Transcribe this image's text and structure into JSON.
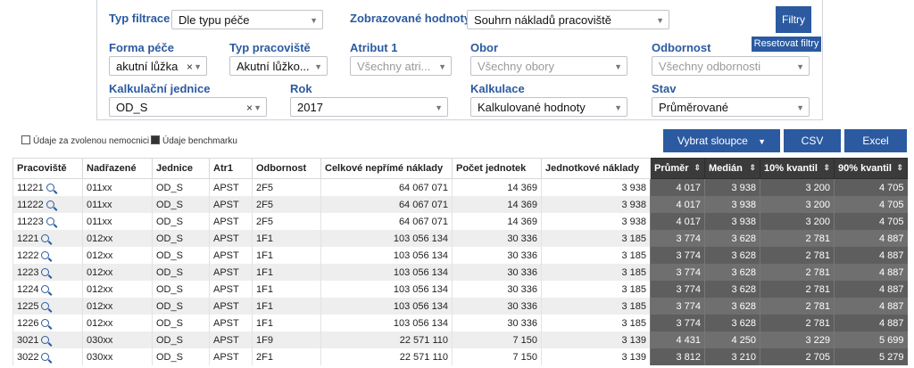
{
  "filters": {
    "typ_filtrace": {
      "label": "Typ filtrace",
      "value": "Dle typu péče"
    },
    "zobrazovane_hodnoty": {
      "label": "Zobrazované hodnoty",
      "value": "Souhrn nákladů pracoviště"
    },
    "filtry_button": "Filtry",
    "reset_button": "Resetovat filtry",
    "forma_pece": {
      "label": "Forma péče",
      "value": "akutní lůžka"
    },
    "typ_pracoviste": {
      "label": "Typ pracoviště",
      "value": "Akutní lůžko..."
    },
    "atribut1": {
      "label": "Atribut 1",
      "placeholder": "Všechny atri..."
    },
    "obor": {
      "label": "Obor",
      "placeholder": "Všechny obory"
    },
    "odbornost": {
      "label": "Odbornost",
      "placeholder": "Všechny odbornosti"
    },
    "kalkulacni_jednice": {
      "label": "Kalkulační jednice",
      "value": "OD_S"
    },
    "rok": {
      "label": "Rok",
      "value": "2017"
    },
    "kalkulace": {
      "label": "Kalkulace",
      "value": "Kalkulované hodnoty"
    },
    "stav": {
      "label": "Stav",
      "value": "Průměrované"
    }
  },
  "legend": {
    "own": "Údaje za zvolenou nemocnici",
    "benchmark": "Údaje benchmarku"
  },
  "actions": {
    "columns": "Vybrat sloupce",
    "csv": "CSV",
    "excel": "Excel"
  },
  "table": {
    "headers": [
      "Pracoviště",
      "Nadřazené",
      "Jednice",
      "Atr1",
      "Odbornost",
      "Celkové nepřímé náklady",
      "Počet jednotek",
      "Jednotkové náklady",
      "Průměr",
      "Medián",
      "10% kvantil",
      "90% kvantil"
    ],
    "rows": [
      [
        "11221",
        "011xx",
        "OD_S",
        "APST",
        "2F5",
        "64 067 071",
        "14 369",
        "3 938",
        "4 017",
        "3 938",
        "3 200",
        "4 705"
      ],
      [
        "11222",
        "011xx",
        "OD_S",
        "APST",
        "2F5",
        "64 067 071",
        "14 369",
        "3 938",
        "4 017",
        "3 938",
        "3 200",
        "4 705"
      ],
      [
        "11223",
        "011xx",
        "OD_S",
        "APST",
        "2F5",
        "64 067 071",
        "14 369",
        "3 938",
        "4 017",
        "3 938",
        "3 200",
        "4 705"
      ],
      [
        "1221",
        "012xx",
        "OD_S",
        "APST",
        "1F1",
        "103 056 134",
        "30 336",
        "3 185",
        "3 774",
        "3 628",
        "2 781",
        "4 887"
      ],
      [
        "1222",
        "012xx",
        "OD_S",
        "APST",
        "1F1",
        "103 056 134",
        "30 336",
        "3 185",
        "3 774",
        "3 628",
        "2 781",
        "4 887"
      ],
      [
        "1223",
        "012xx",
        "OD_S",
        "APST",
        "1F1",
        "103 056 134",
        "30 336",
        "3 185",
        "3 774",
        "3 628",
        "2 781",
        "4 887"
      ],
      [
        "1224",
        "012xx",
        "OD_S",
        "APST",
        "1F1",
        "103 056 134",
        "30 336",
        "3 185",
        "3 774",
        "3 628",
        "2 781",
        "4 887"
      ],
      [
        "1225",
        "012xx",
        "OD_S",
        "APST",
        "1F1",
        "103 056 134",
        "30 336",
        "3 185",
        "3 774",
        "3 628",
        "2 781",
        "4 887"
      ],
      [
        "1226",
        "012xx",
        "OD_S",
        "APST",
        "1F1",
        "103 056 134",
        "30 336",
        "3 185",
        "3 774",
        "3 628",
        "2 781",
        "4 887"
      ],
      [
        "3021",
        "030xx",
        "OD_S",
        "APST",
        "1F9",
        "22 571 110",
        "7 150",
        "3 139",
        "4 431",
        "4 250",
        "3 229",
        "5 699"
      ],
      [
        "3022",
        "030xx",
        "OD_S",
        "APST",
        "2F1",
        "22 571 110",
        "7 150",
        "3 139",
        "3 812",
        "3 210",
        "2 705",
        "5 279"
      ]
    ]
  },
  "colors": {
    "accent": "#2b5aa0",
    "benchmark_dark": "#3b3b3b"
  }
}
